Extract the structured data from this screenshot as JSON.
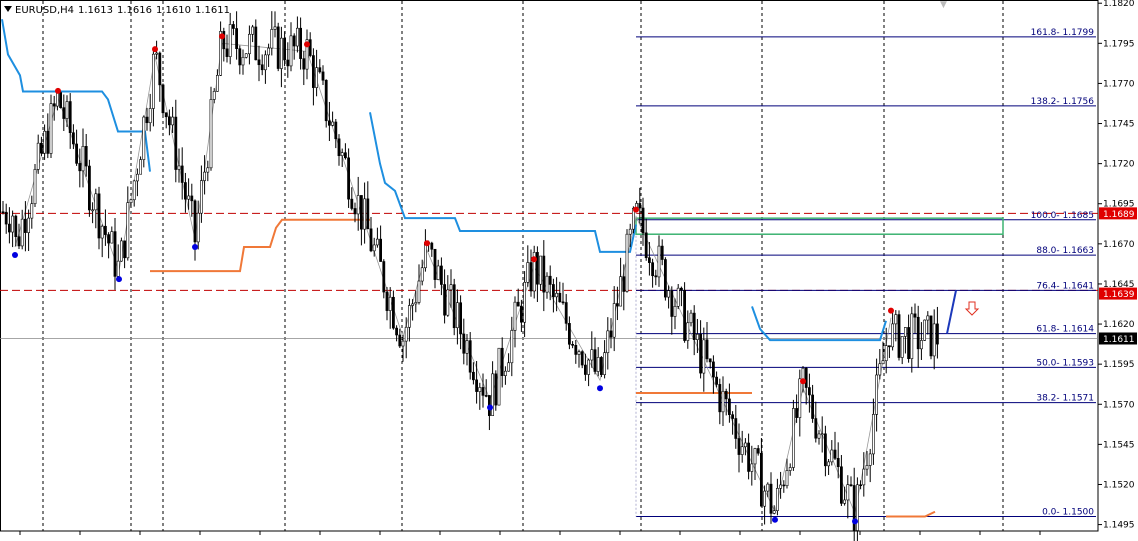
{
  "header": {
    "symbol": "EURUSD,H4",
    "open": "1.1613",
    "high": "1.1616",
    "low": "1.1610",
    "close": "1.1611"
  },
  "chart_data": {
    "type": "candlestick",
    "symbol": "EURUSD",
    "timeframe": "H4",
    "ylim": [
      1.1495,
      1.182
    ],
    "y_ticks": [
      "1.1820",
      "1.1795",
      "1.1770",
      "1.1745",
      "1.1720",
      "1.1695",
      "1.1670",
      "1.1645",
      "1.1620",
      "1.1595",
      "1.1570",
      "1.1545",
      "1.1520",
      "1.1495"
    ],
    "price_labels": [
      {
        "text": "1.1689",
        "value": 1.1689,
        "color": "#e00000"
      },
      {
        "text": "1.1639",
        "value": 1.1639,
        "color": "#e00000"
      },
      {
        "text": "1.1611",
        "value": 1.1611,
        "color": "#000000"
      }
    ],
    "horizontal_dashed_lines": [
      {
        "value": 1.1689,
        "color": "#c00000"
      },
      {
        "value": 1.1641,
        "color": "#c00000"
      }
    ],
    "current_price_line": 1.1611,
    "fibonacci_levels": [
      {
        "label": "161.8- 1.1799",
        "value": 1.1799
      },
      {
        "label": "138.2- 1.1756",
        "value": 1.1756
      },
      {
        "label": "100.0- 1.1685",
        "value": 1.1685
      },
      {
        "label": "88.0- 1.1663",
        "value": 1.1663
      },
      {
        "label": "76.4- 1.1641",
        "value": 1.1641
      },
      {
        "label": "61.8- 1.1614",
        "value": 1.1614
      },
      {
        "label": "50.0- 1.1593",
        "value": 1.1593
      },
      {
        "label": "38.2- 1.1571",
        "value": 1.1571
      },
      {
        "label": "0.0- 1.1500",
        "value": 1.15
      }
    ],
    "zigzag_highs": [
      1.1761,
      1.1787,
      1.1795,
      1.179,
      1.1687,
      1.1666,
      1.1656,
      1.158,
      1.1624
    ],
    "zigzag_lows": [
      1.1668,
      1.1653,
      1.1673,
      1.1573,
      1.1585,
      1.1503,
      1.1502
    ],
    "colors": {
      "candles": "#000000",
      "grid": "#000000",
      "fib": "#00007a",
      "dashed_levels": "#c00000",
      "high_dots": "#e00000",
      "low_dots": "#0000e0",
      "blue_step": "#1e8fe0",
      "orange_step": "#f07838",
      "green_box": "#3cb371",
      "current_line": "#888888",
      "zigzag": "#999999",
      "projection_arrow": "#1c39bb",
      "down_arrow": "#e03020"
    },
    "grid": true
  }
}
